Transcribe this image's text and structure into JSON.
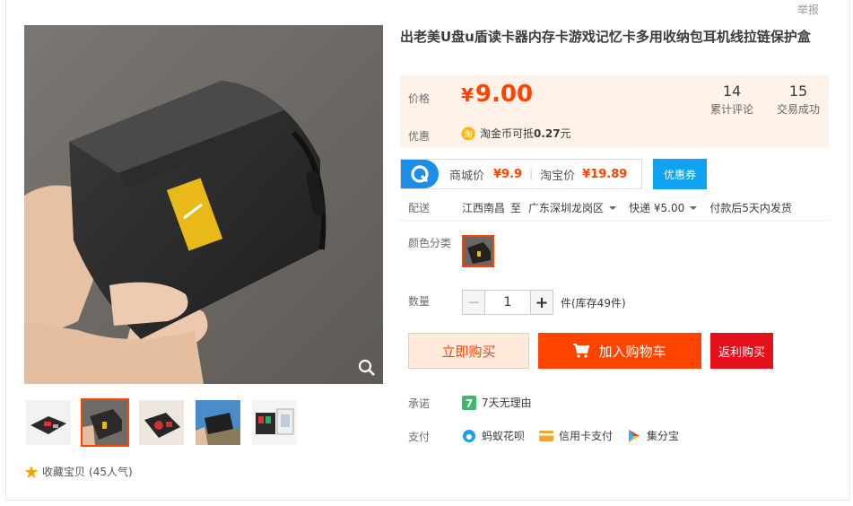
{
  "report_label": "举报",
  "title": "出老美U盘u盾读卡器内存卡游戏记忆卡多用收纳包耳机线拉链保护盒",
  "price": {
    "label": "价格",
    "currency": "¥",
    "value": "9.00",
    "reviews_count": "14",
    "reviews_label": "累计评论",
    "deals_count": "15",
    "deals_label": "交易成功"
  },
  "promo": {
    "label": "优惠",
    "coin_prefix": "淘金币可抵",
    "coin_value": "0.27",
    "coin_suffix": "元"
  },
  "coupon": {
    "mall_label": "商城价",
    "mall_price": "¥9.9",
    "tb_label": "淘宝价",
    "tb_price": "¥19.89",
    "button": "优惠券"
  },
  "shipping": {
    "label": "配送",
    "from": "江西南昌",
    "to_word": "至",
    "to": "广东深圳龙岗区",
    "express": "快递 ¥5.00",
    "delivery": "付款后5天内发货"
  },
  "color": {
    "label": "颜色分类"
  },
  "quantity": {
    "label": "数量",
    "minus": "−",
    "value": "1",
    "plus": "+",
    "stock": "件(库存49件)"
  },
  "actions": {
    "buy_now": "立即购买",
    "add_cart": "加入购物车",
    "rebate": "返利购买"
  },
  "promise": {
    "label": "承诺",
    "text": "7天无理由"
  },
  "payment": {
    "label": "支付",
    "methods": [
      "蚂蚁花呗",
      "信用卡支付",
      "集分宝"
    ]
  },
  "favorite": {
    "text": "收藏宝贝",
    "count": "(45人气)"
  },
  "colors": {
    "accent": "#ff4400",
    "price_bg": "#fff2e8",
    "coupon_blue": "#0ea2f0"
  }
}
